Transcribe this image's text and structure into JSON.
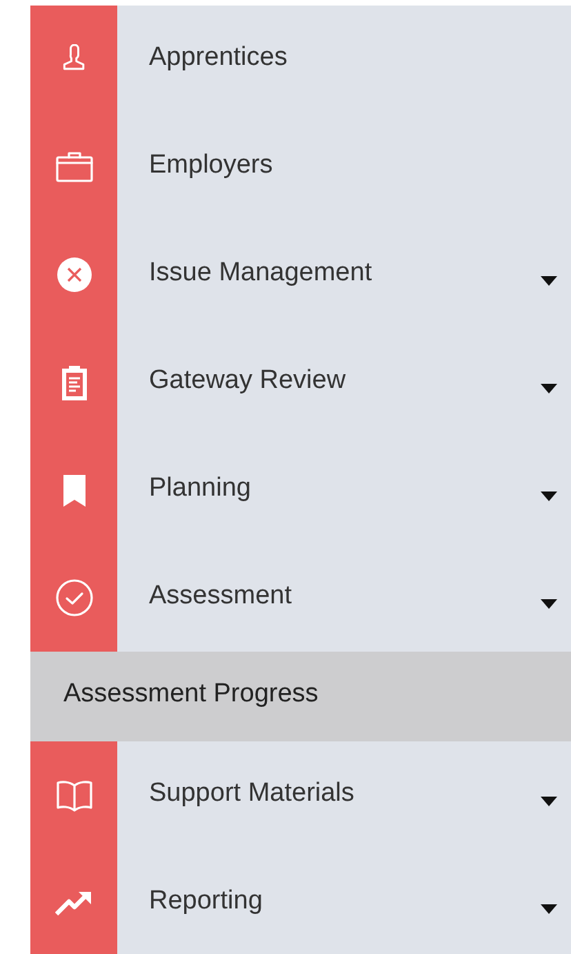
{
  "sidebar": {
    "items": [
      {
        "label": "Apprentices",
        "kind": "link"
      },
      {
        "label": "Employers",
        "kind": "link"
      },
      {
        "label": "Issue Management",
        "kind": "dropdown"
      },
      {
        "label": "Gateway Review",
        "kind": "dropdown"
      },
      {
        "label": "Planning",
        "kind": "dropdown"
      },
      {
        "label": "Assessment",
        "kind": "dropdown",
        "children": [
          {
            "label": "Assessment Progress"
          }
        ]
      },
      {
        "label": "Support Materials",
        "kind": "dropdown"
      },
      {
        "label": "Reporting",
        "kind": "dropdown"
      }
    ]
  }
}
